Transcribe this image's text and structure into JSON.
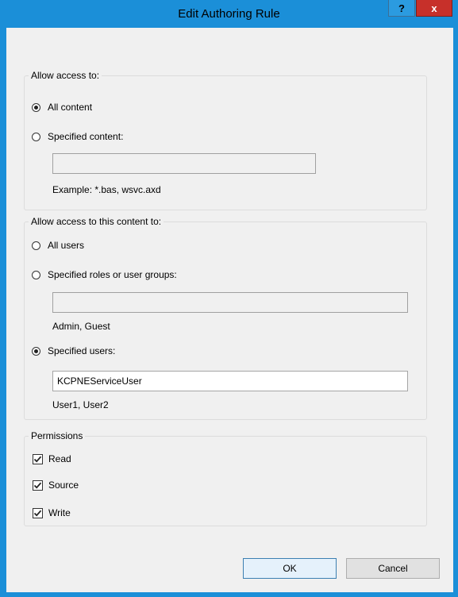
{
  "window": {
    "title": "Edit Authoring Rule",
    "help_label": "?",
    "close_label": "x"
  },
  "allow_access": {
    "legend": "Allow access to:",
    "all_content": {
      "label": "All content",
      "selected": true
    },
    "specified_content": {
      "label": "Specified content:",
      "selected": false,
      "value": ""
    },
    "example": "Example: *.bas, wsvc.axd"
  },
  "content_to": {
    "legend": "Allow access to this content to:",
    "all_users": {
      "label": "All users",
      "selected": false
    },
    "specified_roles": {
      "label": "Specified roles or user groups:",
      "selected": false,
      "value": ""
    },
    "roles_hint": "Admin, Guest",
    "specified_users": {
      "label": "Specified users:",
      "selected": true,
      "value": "KCPNEServiceUser"
    },
    "users_hint": "User1, User2"
  },
  "permissions": {
    "legend": "Permissions",
    "items": [
      {
        "label": "Read",
        "checked": true
      },
      {
        "label": "Source",
        "checked": true
      },
      {
        "label": "Write",
        "checked": true
      }
    ]
  },
  "buttons": {
    "ok": "OK",
    "cancel": "Cancel"
  }
}
